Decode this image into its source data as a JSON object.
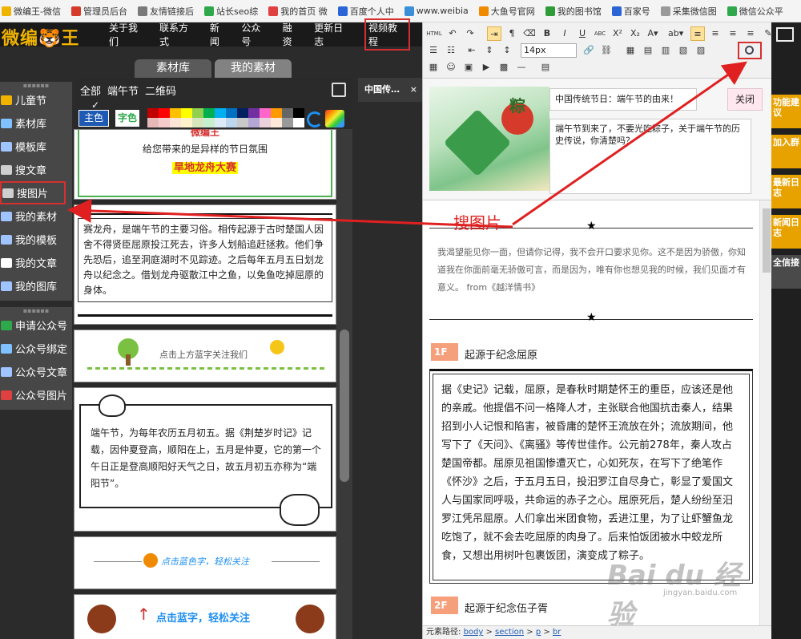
{
  "bookmarks": [
    {
      "label": "微编王-微信",
      "color": "#f0b400"
    },
    {
      "label": "管理员后台",
      "color": "#d63a2a"
    },
    {
      "label": "友情链接后",
      "color": "#7a7a7a"
    },
    {
      "label": "站长seo综",
      "color": "#2ea84a"
    },
    {
      "label": "我的首页 微",
      "color": "#e04040"
    },
    {
      "label": "百度个人中",
      "color": "#2b64d6"
    },
    {
      "label": "www.weibia",
      "color": "#3a8fd6"
    },
    {
      "label": "大鱼号官网",
      "color": "#f08a00"
    },
    {
      "label": "我的图书馆",
      "color": "#2f9c3a"
    },
    {
      "label": "百家号",
      "color": "#2b64d6"
    },
    {
      "label": "采集微信图",
      "color": "#9a9a9a"
    },
    {
      "label": "微信公众平",
      "color": "#2ea84a"
    }
  ],
  "header": {
    "logo": "微编🐯王",
    "nav": [
      "关于我们",
      "联系方式",
      "新闻",
      "公众号",
      "融资",
      "更新日志",
      "视频教程"
    ]
  },
  "sidebar": {
    "group1": [
      {
        "label": "儿童节",
        "color": "#f0b400"
      },
      {
        "label": "素材库",
        "color": "#7fc2ff"
      },
      {
        "label": "模板库",
        "color": "#a0c4ff"
      },
      {
        "label": "搜文章",
        "color": "#cfcfcf"
      },
      {
        "label": "搜图片",
        "color": "#cfcfcf"
      },
      {
        "label": "我的素材",
        "color": "#a0c4ff"
      },
      {
        "label": "我的模板",
        "color": "#a0c4ff"
      },
      {
        "label": "我的文章",
        "color": "#ffffff"
      },
      {
        "label": "我的图库",
        "color": "#a0c4ff"
      }
    ],
    "group2": [
      {
        "label": "申请公众号",
        "color": "#2ea84a"
      },
      {
        "label": "公众号绑定",
        "color": "#7fc2ff"
      },
      {
        "label": "公众号文章",
        "color": "#a0c4ff"
      },
      {
        "label": "公众号图片",
        "color": "#e04040"
      }
    ]
  },
  "tabs": {
    "material_lib": "素材库",
    "my_material": "我的素材"
  },
  "filter": {
    "all": "全部",
    "dragon_boat": "端午节",
    "qrcode": "二维码"
  },
  "colorbar": {
    "main_color": "主色",
    "font_color": "字色",
    "swatches": [
      "#c00000",
      "#ff0000",
      "#ffc000",
      "#ffff00",
      "#92d050",
      "#00b050",
      "#00b0f0",
      "#0070c0",
      "#002060",
      "#7030a0",
      "#ff66cc",
      "#ff9900",
      "#666666",
      "#000000",
      "#e6b8b7",
      "#f4cccc",
      "#fce4d6",
      "#fff2cc",
      "#d8e4bc",
      "#c6efce",
      "#ddebf7",
      "#bdd7ee",
      "#c9c9c9",
      "#b4a7d6",
      "#ead1dc",
      "#fde9d9",
      "#999999",
      "#ffffff"
    ]
  },
  "cards": {
    "card1_sub": "给您带来的是异样的节日氛围",
    "card1_head": "旱地龙舟大赛",
    "card1_top": "微编王",
    "card2_text": "赛龙舟，是端午节的主要习俗。相传起源于古时楚国人因舍不得贤臣屈原投江死去，许多人划船追赶拯救。他们争先恐后，追至洞庭湖时不见踪迹。之后每年五月五日划龙舟以纪念之。借划龙舟驱散江中之鱼，以免鱼吃掉屈原的身体。",
    "card3_text": "点击上方蓝字关注我们",
    "card3_blue": "蓝字",
    "card4_text": "端午节，为每年农历五月初五。据《荆楚岁时记》记载，因仲夏登高，顺阳在上，五月是仲夏，它的第一个午日正是登高顺阳好天气之日，故五月初五亦称为“端阳节”。",
    "card5_text": "点击蓝色字，轻松关注",
    "card6_text": "点击蓝字，轻松关注"
  },
  "editor": {
    "tab_label": "中国传…",
    "tab_close": "×",
    "font_size": "14px",
    "title": "中国传统节日：端午节的由来！",
    "close_label": "关闭",
    "digest": "端午节到来了，不要光吃粽子，关于端午节的历史传说，你清楚吗？",
    "thumb_text": "粽",
    "poem": "我渴望能见你一面，但请你记得，我不会开口要求见你。这不是因为骄傲，你知道我在你面前毫无骄傲可言，而是因为，唯有你也想见我的时候，我们见面才有意义。 from《越洋情书》",
    "section1_num": "1F",
    "section1_title": "起源于纪念屈原",
    "section1_text": "据《史记》记载，屈原，是春秋时期楚怀王的重臣，应该还是他的亲戚。他提倡不问一格降人才，主张联合他国抗击秦人，结果招到小人记恨和陷害，被昏庸的楚怀王流放在外；流放期间，他写下了《天问》、《离骚》等传世佳作。公元前278年，秦人攻占楚国帝都。屈原见祖国惨遭灭亡，心如死灰，在写下了绝笔作《怀沙》之后，于五月五日，投汨罗江自尽身亡，彰显了爱国文人与国家同呼吸，共命运的赤子之心。屈原死后，楚人纷纷至汨罗江凭吊屈原。人们拿出米团食物，丢进江里，为了让虾蟹鱼龙吃饱了，就不会去吃屈原的肉身了。后来怕饭团被水中蛟龙所食，又想出用树叶包裹饭团，演变成了粽子。",
    "section2_num": "2F",
    "section2_title": "起源于纪念伍子胥",
    "status_label": "元素路径:",
    "path": [
      "body",
      "section",
      "p",
      "br"
    ]
  },
  "rstrip": [
    "功能建议",
    "加入群",
    "最新日志",
    "新闻日志",
    "全信接"
  ],
  "annotation": "搜图片",
  "watermark": "Bai du 经验",
  "watermark_url": "jingyan.baidu.com"
}
